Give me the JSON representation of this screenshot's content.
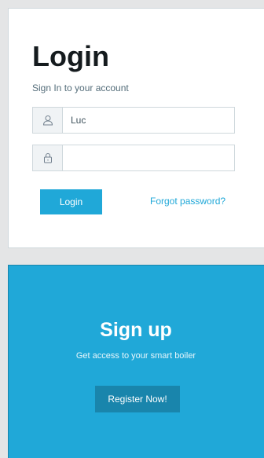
{
  "login": {
    "title": "Login",
    "subtitle": "Sign In to your account",
    "username": {
      "value": "Luc",
      "placeholder": "",
      "icon": "user-icon"
    },
    "password": {
      "value": "",
      "placeholder": "",
      "icon": "lock-icon"
    },
    "submit_label": "Login",
    "forgot_label": "Forgot password?"
  },
  "signup": {
    "title": "Sign up",
    "subtitle": "Get access to your smart boiler",
    "register_label": "Register Now!"
  },
  "colors": {
    "background": "#e4e5e6",
    "accent": "#20a8d8",
    "accent_dark": "#1985ac",
    "heading": "#151b1e",
    "muted": "#536c79"
  }
}
